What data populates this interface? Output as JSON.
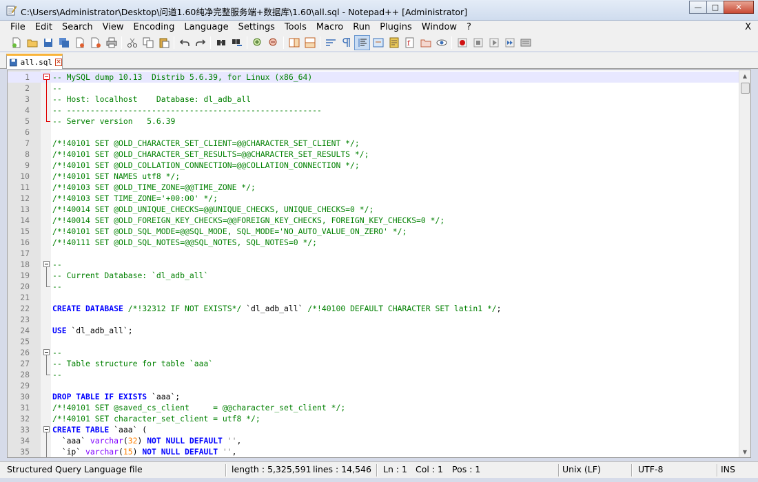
{
  "window": {
    "title": "C:\\Users\\Administrator\\Desktop\\问道1.60纯净完整服务端+数据库\\1.60\\all.sql - Notepad++ [Administrator]",
    "minimize": "—",
    "maximize": "□",
    "close": "✕"
  },
  "menu": {
    "items": [
      "File",
      "Edit",
      "Search",
      "View",
      "Encoding",
      "Language",
      "Settings",
      "Tools",
      "Macro",
      "Run",
      "Plugins",
      "Window",
      "?"
    ],
    "close_label": "X"
  },
  "tab": {
    "label": "all.sql",
    "close": "×"
  },
  "editor": {
    "lines": [
      {
        "n": "1",
        "parts": [
          [
            "c-comment",
            "-- MySQL dump 10.13  Distrib 5.6.39, for Linux (x86_64)"
          ]
        ]
      },
      {
        "n": "2",
        "parts": [
          [
            "c-comment",
            "--"
          ]
        ]
      },
      {
        "n": "3",
        "parts": [
          [
            "c-comment",
            "-- Host: localhost    Database: dl_adb_all"
          ]
        ]
      },
      {
        "n": "4",
        "parts": [
          [
            "c-comment",
            "-- ------------------------------------------------------"
          ]
        ]
      },
      {
        "n": "5",
        "parts": [
          [
            "c-comment",
            "-- Server version\t5.6.39"
          ]
        ]
      },
      {
        "n": "6",
        "parts": []
      },
      {
        "n": "7",
        "parts": [
          [
            "c-comment",
            "/*!40101 SET @OLD_CHARACTER_SET_CLIENT=@@CHARACTER_SET_CLIENT */;"
          ]
        ]
      },
      {
        "n": "8",
        "parts": [
          [
            "c-comment",
            "/*!40101 SET @OLD_CHARACTER_SET_RESULTS=@@CHARACTER_SET_RESULTS */;"
          ]
        ]
      },
      {
        "n": "9",
        "parts": [
          [
            "c-comment",
            "/*!40101 SET @OLD_COLLATION_CONNECTION=@@COLLATION_CONNECTION */;"
          ]
        ]
      },
      {
        "n": "10",
        "parts": [
          [
            "c-comment",
            "/*!40101 SET NAMES utf8 */;"
          ]
        ]
      },
      {
        "n": "11",
        "parts": [
          [
            "c-comment",
            "/*!40103 SET @OLD_TIME_ZONE=@@TIME_ZONE */;"
          ]
        ]
      },
      {
        "n": "12",
        "parts": [
          [
            "c-comment",
            "/*!40103 SET TIME_ZONE='+00:00' */;"
          ]
        ]
      },
      {
        "n": "13",
        "parts": [
          [
            "c-comment",
            "/*!40014 SET @OLD_UNIQUE_CHECKS=@@UNIQUE_CHECKS, UNIQUE_CHECKS=0 */;"
          ]
        ]
      },
      {
        "n": "14",
        "parts": [
          [
            "c-comment",
            "/*!40014 SET @OLD_FOREIGN_KEY_CHECKS=@@FOREIGN_KEY_CHECKS, FOREIGN_KEY_CHECKS=0 */;"
          ]
        ]
      },
      {
        "n": "15",
        "parts": [
          [
            "c-comment",
            "/*!40101 SET @OLD_SQL_MODE=@@SQL_MODE, SQL_MODE='NO_AUTO_VALUE_ON_ZERO' */;"
          ]
        ]
      },
      {
        "n": "16",
        "parts": [
          [
            "c-comment",
            "/*!40111 SET @OLD_SQL_NOTES=@@SQL_NOTES, SQL_NOTES=0 */;"
          ]
        ]
      },
      {
        "n": "17",
        "parts": []
      },
      {
        "n": "18",
        "parts": [
          [
            "c-comment",
            "--"
          ]
        ]
      },
      {
        "n": "19",
        "parts": [
          [
            "c-comment",
            "-- Current Database: `dl_adb_all`"
          ]
        ]
      },
      {
        "n": "20",
        "parts": [
          [
            "c-comment",
            "--"
          ]
        ]
      },
      {
        "n": "21",
        "parts": []
      },
      {
        "n": "22",
        "parts": [
          [
            "c-kw",
            "CREATE DATABASE"
          ],
          [
            "c-text",
            " "
          ],
          [
            "c-comment",
            "/*!32312 IF NOT EXISTS*/"
          ],
          [
            "c-text",
            " `dl_adb_all` "
          ],
          [
            "c-comment",
            "/*!40100 DEFAULT CHARACTER SET latin1 */"
          ],
          [
            "c-text",
            ";"
          ]
        ]
      },
      {
        "n": "23",
        "parts": []
      },
      {
        "n": "24",
        "parts": [
          [
            "c-kw",
            "USE"
          ],
          [
            "c-text",
            " `dl_adb_all`;"
          ]
        ]
      },
      {
        "n": "25",
        "parts": []
      },
      {
        "n": "26",
        "parts": [
          [
            "c-comment",
            "--"
          ]
        ]
      },
      {
        "n": "27",
        "parts": [
          [
            "c-comment",
            "-- Table structure for table `aaa`"
          ]
        ]
      },
      {
        "n": "28",
        "parts": [
          [
            "c-comment",
            "--"
          ]
        ]
      },
      {
        "n": "29",
        "parts": []
      },
      {
        "n": "30",
        "parts": [
          [
            "c-kw",
            "DROP TABLE IF EXISTS"
          ],
          [
            "c-text",
            " `aaa`;"
          ]
        ]
      },
      {
        "n": "31",
        "parts": [
          [
            "c-comment",
            "/*!40101 SET @saved_cs_client     = @@character_set_client */;"
          ]
        ]
      },
      {
        "n": "32",
        "parts": [
          [
            "c-comment",
            "/*!40101 SET character_set_client = utf8 */;"
          ]
        ]
      },
      {
        "n": "33",
        "parts": [
          [
            "c-kw",
            "CREATE TABLE"
          ],
          [
            "c-text",
            " `aaa` ("
          ]
        ]
      },
      {
        "n": "34",
        "parts": [
          [
            "c-text",
            "  `aaa` "
          ],
          [
            "c-type",
            "varchar"
          ],
          [
            "c-text",
            "("
          ],
          [
            "c-num",
            "32"
          ],
          [
            "c-text",
            ") "
          ],
          [
            "c-kw",
            "NOT NULL DEFAULT"
          ],
          [
            "c-text",
            " "
          ],
          [
            "c-str",
            "''"
          ],
          [
            "c-text",
            ","
          ]
        ]
      },
      {
        "n": "35",
        "parts": [
          [
            "c-text",
            "  `ip` "
          ],
          [
            "c-type",
            "varchar"
          ],
          [
            "c-text",
            "("
          ],
          [
            "c-num",
            "15"
          ],
          [
            "c-text",
            ") "
          ],
          [
            "c-kw",
            "NOT NULL DEFAULT"
          ],
          [
            "c-text",
            " "
          ],
          [
            "c-str",
            "''"
          ],
          [
            "c-text",
            ","
          ]
        ]
      }
    ]
  },
  "status": {
    "language": "Structured Query Language file",
    "length": "length : 5,325,591",
    "lines": "lines : 14,546",
    "ln": "Ln : 1",
    "col": "Col : 1",
    "pos": "Pos : 1",
    "eol": "Unix (LF)",
    "encoding": "UTF-8",
    "mode": "INS"
  }
}
